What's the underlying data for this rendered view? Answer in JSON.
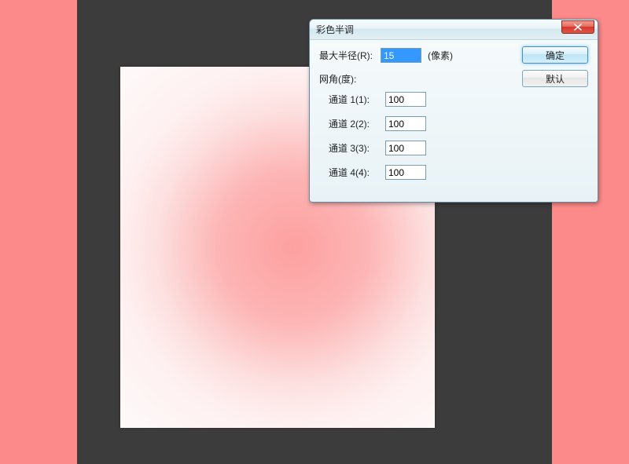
{
  "dialog": {
    "title": "彩色半调",
    "radius_label": "最大半径(R):",
    "radius_value": "15",
    "radius_unit": "(像素)",
    "grid_label": "网角(度):",
    "channels": [
      {
        "label": "通道 1(1):",
        "value": "100"
      },
      {
        "label": "通道 2(2):",
        "value": "100"
      },
      {
        "label": "通道 3(3):",
        "value": "100"
      },
      {
        "label": "通道 4(4):",
        "value": "100"
      }
    ],
    "ok_label": "确定",
    "default_label": "默认"
  }
}
